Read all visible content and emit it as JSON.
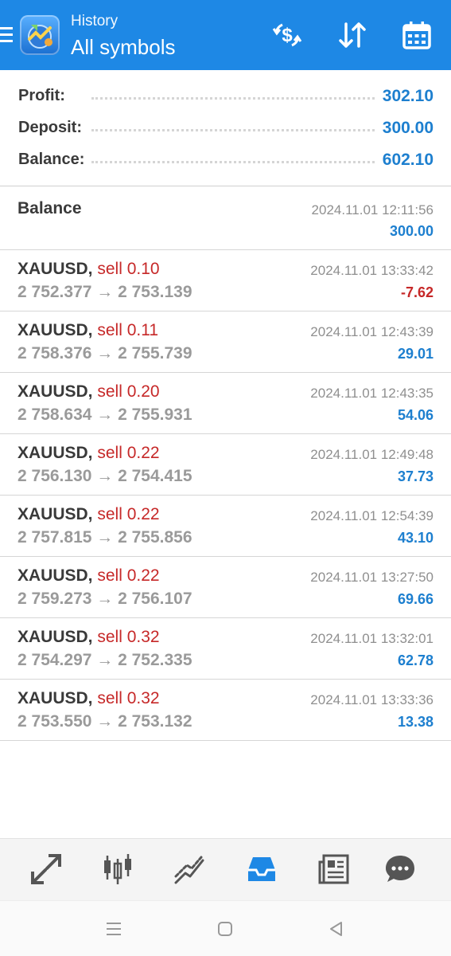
{
  "header": {
    "subtitle": "History",
    "title": "All symbols"
  },
  "summary": [
    {
      "label": "Profit:",
      "value": "302.10"
    },
    {
      "label": "Deposit:",
      "value": "300.00"
    },
    {
      "label": "Balance:",
      "value": "602.10"
    }
  ],
  "balance_entry": {
    "label": "Balance",
    "time": "2024.11.01 12:11:56",
    "amount": "300.00"
  },
  "deals": [
    {
      "symbol": "XAUUSD,",
      "side": "sell 0.10",
      "prices": "2 752.377 → 2 753.139",
      "time": "2024.11.01 13:33:42",
      "profit": "-7.62"
    },
    {
      "symbol": "XAUUSD,",
      "side": "sell 0.11",
      "prices": "2 758.376 → 2 755.739",
      "time": "2024.11.01 12:43:39",
      "profit": "29.01"
    },
    {
      "symbol": "XAUUSD,",
      "side": "sell 0.20",
      "prices": "2 758.634 → 2 755.931",
      "time": "2024.11.01 12:43:35",
      "profit": "54.06"
    },
    {
      "symbol": "XAUUSD,",
      "side": "sell 0.22",
      "prices": "2 756.130 → 2 754.415",
      "time": "2024.11.01 12:49:48",
      "profit": "37.73"
    },
    {
      "symbol": "XAUUSD,",
      "side": "sell 0.22",
      "prices": "2 757.815 → 2 755.856",
      "time": "2024.11.01 12:54:39",
      "profit": "43.10"
    },
    {
      "symbol": "XAUUSD,",
      "side": "sell 0.22",
      "prices": "2 759.273 → 2 756.107",
      "time": "2024.11.01 13:27:50",
      "profit": "69.66"
    },
    {
      "symbol": "XAUUSD,",
      "side": "sell 0.32",
      "prices": "2 754.297 → 2 752.335",
      "time": "2024.11.01 13:32:01",
      "profit": "62.78"
    },
    {
      "symbol": "XAUUSD,",
      "side": "sell 0.32",
      "prices": "2 753.550 → 2 753.132",
      "time": "2024.11.01 13:33:36",
      "profit": "13.38"
    }
  ],
  "icons": {
    "header": [
      "menu-icon",
      "app-logo",
      "currency-exchange-icon",
      "sort-icon",
      "calendar-icon"
    ],
    "bottom_nav": [
      "trade-icon",
      "chart-candles-icon",
      "trendline-icon",
      "history-inbox-icon",
      "news-icon",
      "chat-icon"
    ],
    "system": [
      "recents-icon",
      "home-icon",
      "back-icon"
    ]
  },
  "colors": {
    "header_bg": "#1E88E5",
    "value_blue": "#1d7fcf",
    "sell_red": "#c62828",
    "active_nav": "#1E88E5"
  }
}
